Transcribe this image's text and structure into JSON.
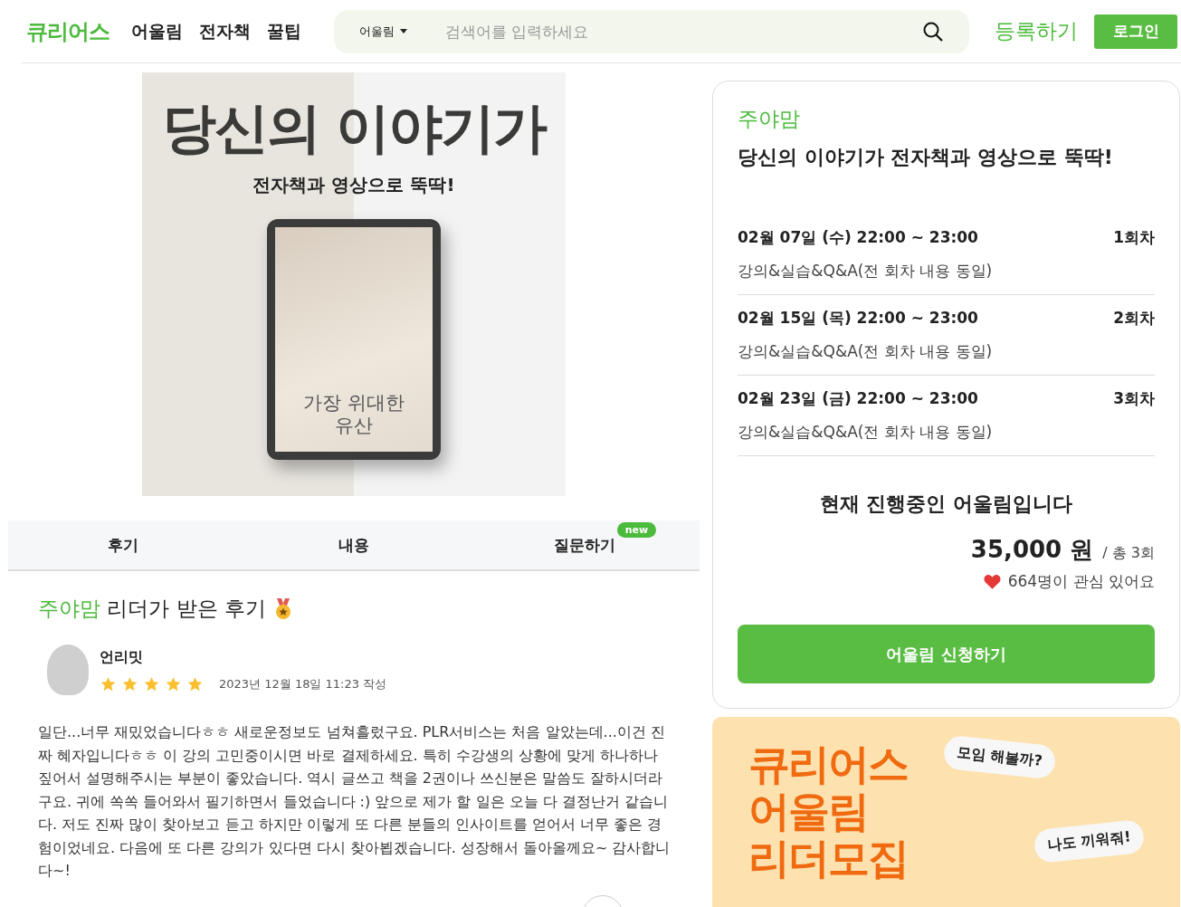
{
  "header": {
    "logo": "큐리어스",
    "nav": [
      "어울림",
      "전자책",
      "꿀팁"
    ],
    "search": {
      "category": "어울림",
      "placeholder": "검색어를 입력하세요"
    },
    "register": "등록하기",
    "login": "로그인"
  },
  "cover": {
    "title": "당신의 이야기가",
    "subtitle": "전자책과 영상으로 뚝딱!",
    "tablet_text": [
      "가장 위대한",
      "유산"
    ]
  },
  "tabs": [
    {
      "label": "후기"
    },
    {
      "label": "내용"
    },
    {
      "label": "질문하기",
      "badge": "new"
    }
  ],
  "reviews": {
    "leader": "주야맘",
    "heading": "리더가 받은 후기",
    "items": [
      {
        "author": "언리밋",
        "stars": 5,
        "date": "2023년 12월 18일 11:23 작성",
        "text": "일단...너무 재밌었습니다ㅎㅎ 새로운정보도 넘쳐흘렀구요. PLR서비스는 처음 알았는데...이건 진짜 혜자입니다ㅎㅎ 이 강의 고민중이시면 바로 결제하세요. 특히 수강생의 상황에 맞게 하나하나 짚어서 설명해주시는 부분이 좋았습니다. 역시 글쓰고 책을 2권이나 쓰신분은 말씀도 잘하시더라구요. 귀에 쏙쏙 들어와서 필기하면서 들었습니다 :) 앞으로 제가 할 일은 오늘 다 결정난거 같습니다. 저도 진짜 많이 찾아보고 듣고 하지만 이렇게 또 다른 분들의 인사이트를 얻어서 너무 좋은 경험이었네요. 다음에 또 다른 강의가 있다면 다시 찾아뵙겠습니다. 성장해서 돌아올께요~ 감사합니다~!"
      }
    ]
  },
  "course": {
    "leader": "주야맘",
    "title": "당신의 이야기가 전자책과 영상으로 뚝딱!",
    "sessions": [
      {
        "date": "02월 07일 (수) 22:00 ~ 23:00",
        "round": "1회차",
        "desc": "강의&실습&Q&A(전 회차 내용 동일)"
      },
      {
        "date": "02월 15일 (목) 22:00 ~ 23:00",
        "round": "2회차",
        "desc": "강의&실습&Q&A(전 회차 내용 동일)"
      },
      {
        "date": "02월 23일 (금) 22:00 ~ 23:00",
        "round": "3회차",
        "desc": "강의&실습&Q&A(전 회차 내용 동일)"
      }
    ],
    "status": "현재 진행중인 어울림입니다",
    "price": "35,000 원",
    "total": "/ 총 3회",
    "interest": "664명이 관심 있어요",
    "apply": "어울림 신청하기"
  },
  "banner": {
    "title": [
      "큐리어스",
      "어울림",
      "리더모집"
    ],
    "bubbles": [
      "모임 해볼까?",
      "나도 끼워줘!"
    ]
  }
}
